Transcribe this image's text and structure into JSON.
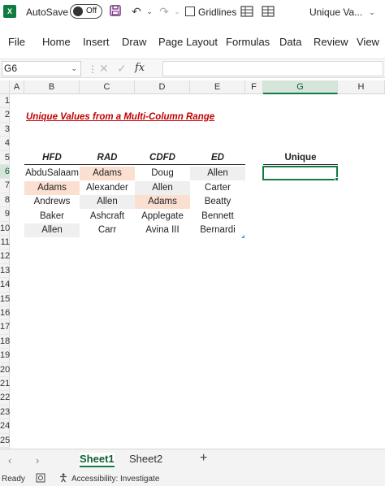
{
  "titlebar": {
    "autosave_label": "AutoSave",
    "autosave_state": "Off",
    "gridlines_label": "Gridlines",
    "doc_title": "Unique Va...",
    "app_icon": "X"
  },
  "ribbon": {
    "tabs": [
      "File",
      "Home",
      "Insert",
      "Draw",
      "Page Layout",
      "Formulas",
      "Data",
      "Review",
      "View"
    ]
  },
  "formula_bar": {
    "name_box": "G6",
    "fx": "fx",
    "formula": ""
  },
  "grid": {
    "columns": [
      "A",
      "B",
      "C",
      "D",
      "E",
      "F",
      "G",
      "H"
    ],
    "active_column": "G",
    "rows": [
      "1",
      "2",
      "3",
      "4",
      "5",
      "6",
      "7",
      "8",
      "9",
      "10",
      "11",
      "12",
      "13",
      "14",
      "15",
      "16",
      "17",
      "18",
      "19",
      "20",
      "21",
      "22",
      "23",
      "24",
      "25"
    ],
    "active_row": "6",
    "title": "Unique Values from a Multi-Column Range",
    "table_headers": [
      "HFD",
      "RAD",
      "CDFD",
      "ED"
    ],
    "table_rows": [
      [
        "AbduSalaam",
        "Adams",
        "Doug",
        "Allen"
      ],
      [
        "Adams",
        "Alexander",
        "Allen",
        "Carter"
      ],
      [
        "Andrews",
        "Allen",
        "Adams",
        "Beatty"
      ],
      [
        "Baker",
        "Ashcraft",
        "Applegate",
        "Bennett"
      ],
      [
        "Allen",
        "Carr",
        "Avina III",
        "Bernardi"
      ]
    ],
    "unique_header": "Unique"
  },
  "sheets": {
    "tabs": [
      "Sheet1",
      "Sheet2"
    ],
    "active": "Sheet1",
    "add": "+"
  },
  "status": {
    "ready": "Ready",
    "accessibility": "Accessibility: Investigate"
  },
  "colors": {
    "excel_green": "#107c41",
    "title_red": "#c00000",
    "peach_fill": "#fbe0d2",
    "grey_fill": "#efefef"
  }
}
